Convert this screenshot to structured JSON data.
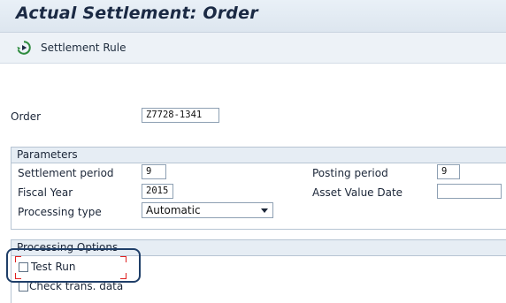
{
  "window": {
    "title": "Actual Settlement: Order"
  },
  "toolbar": {
    "settlement_rule_label": "Settlement Rule",
    "settlement_rule_icon": "execute-icon"
  },
  "order": {
    "label": "Order",
    "value": "Z7728-1341"
  },
  "parameters": {
    "title": "Parameters",
    "settlement_period": {
      "label": "Settlement period",
      "value": "9"
    },
    "fiscal_year": {
      "label": "Fiscal Year",
      "value": "2015"
    },
    "processing_type": {
      "label": "Processing type",
      "value": "Automatic"
    },
    "posting_period": {
      "label": "Posting period",
      "value": "9"
    },
    "asset_value_date": {
      "label": "Asset Value Date",
      "value": ""
    }
  },
  "processing_options": {
    "title": "Processing Options",
    "test_run": {
      "label": "Test Run",
      "checked": false
    },
    "check_trans_data": {
      "label": "Check trans. data",
      "checked": false
    }
  },
  "colors": {
    "title_text": "#1b2a44",
    "highlight_frame": "#1f3e68",
    "focus_marker": "#e02020",
    "icon_green": "#2e8b3e"
  }
}
